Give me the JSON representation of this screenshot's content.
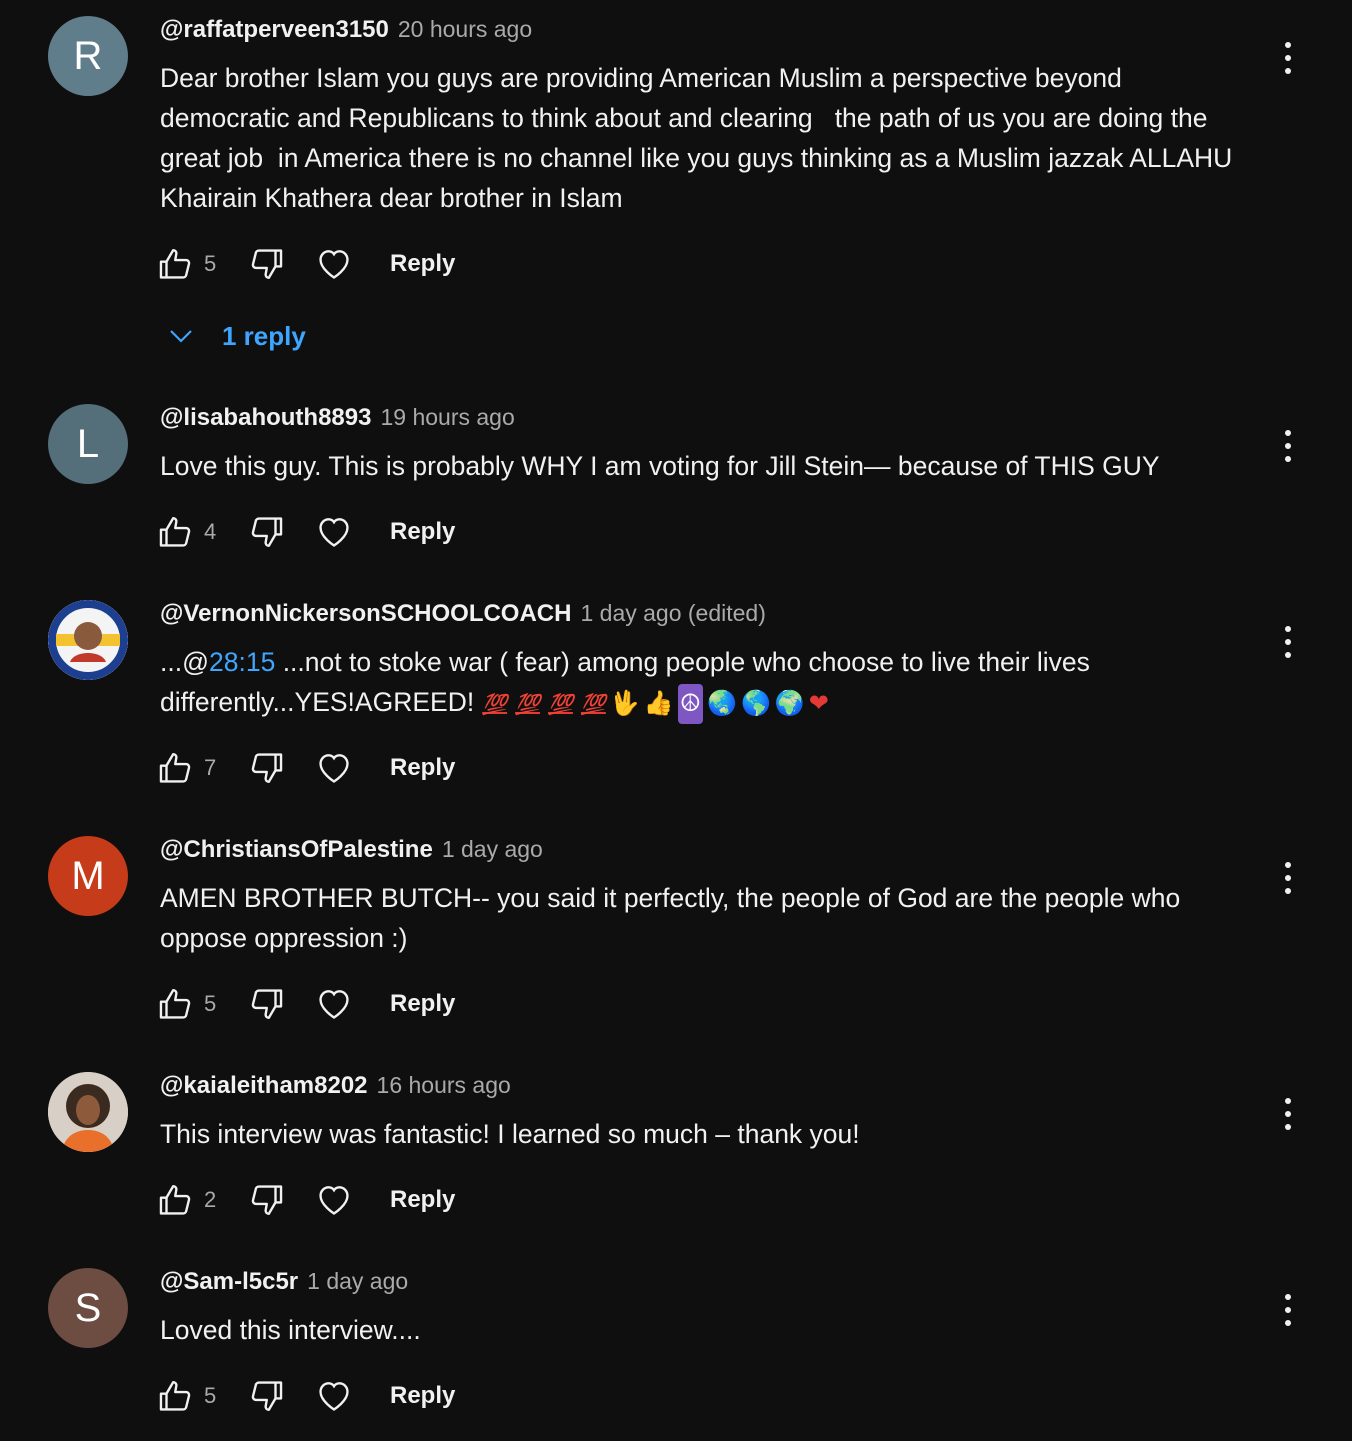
{
  "comments": [
    {
      "avatar_letter": "R",
      "avatar_color": "#607d8b",
      "author": "@raffatperveen3150",
      "time": "20 hours ago",
      "text": "Dear brother Islam you guys are providing American Muslim a perspective beyond democratic and Republicans to think about and clearing   the path of us you are doing the great job  in America there is no channel like you guys thinking as a Muslim jazzak ALLAHU Khairain Khathera dear brother in Islam",
      "likes": "5",
      "reply_label": "Reply",
      "replies_label": "1 reply"
    },
    {
      "avatar_letter": "L",
      "avatar_color": "#546e7a",
      "author": "@lisabahouth8893",
      "time": "19 hours ago",
      "text": "Love this guy. This is probably WHY I am voting for Jill Stein— because of THIS GUY",
      "likes": "4",
      "reply_label": "Reply"
    },
    {
      "avatar_image": "quality-content-badge-avatar",
      "author": "@VernonNickersonSCHOOLCOACH",
      "time": "1 day ago (edited)",
      "text_prefix": "...@",
      "timestamp_link": "28:15",
      "text_line1_rest": " ...not to stoke war ( fear) among people who choose to live their lives",
      "text_line2": "differently...YES!AGREED!",
      "emojis": [
        "💯",
        "💯",
        "💯",
        "💯",
        "🖖",
        "👍",
        "☮",
        "🌏",
        "🌎",
        "🌍",
        "❤"
      ],
      "likes": "7",
      "reply_label": "Reply"
    },
    {
      "avatar_letter": "M",
      "avatar_color": "#c63b1a",
      "author": "@ChristiansOfPalestine",
      "time": "1 day ago",
      "text": "AMEN BROTHER BUTCH-- you said it perfectly, the people of God are the people who oppose oppression :)",
      "likes": "5",
      "reply_label": "Reply"
    },
    {
      "avatar_image": "woman-profile-photo-avatar",
      "author": "@kaialeitham8202",
      "time": "16 hours ago",
      "text": "This interview was fantastic! I learned so much – thank you!",
      "likes": "2",
      "reply_label": "Reply"
    },
    {
      "avatar_letter": "S",
      "avatar_color": "#6d4c41",
      "author": "@Sam-l5c5r",
      "time": "1 day ago",
      "text": "Loved this interview....",
      "likes": "5",
      "reply_label": "Reply"
    }
  ],
  "icons": {
    "like": "thumbs-up-icon",
    "dislike": "thumbs-down-icon",
    "heart": "heart-icon",
    "more": "more-vert-icon",
    "expand": "chevron-down-icon"
  },
  "colors": {
    "background": "#0f0f0f",
    "link": "#3ea6ff",
    "secondary_text": "#aaaaaa"
  }
}
